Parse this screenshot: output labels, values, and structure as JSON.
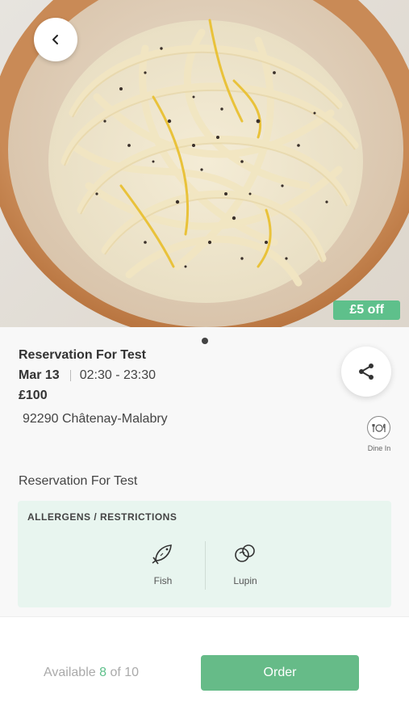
{
  "hero": {
    "discount": "£5 off",
    "carousel_count": 1,
    "carousel_active": 0
  },
  "listing": {
    "title": "Reservation For Test",
    "date": "Mar 13",
    "time": "02:30 - 23:30",
    "price": "£100",
    "address": "92290 Châtenay-Malabry",
    "service_type": "Dine In",
    "description": "Reservation For Test"
  },
  "allergens": {
    "title": "ALLERGENS / RESTRICTIONS",
    "items": [
      {
        "label": "Fish",
        "icon": "fish-icon"
      },
      {
        "label": "Lupin",
        "icon": "lupin-icon"
      }
    ]
  },
  "footer": {
    "available_prefix": "Available",
    "available_count": "8",
    "available_suffix": "of 10",
    "order_label": "Order"
  },
  "colors": {
    "accent": "#5ec08b",
    "allergen_bg": "#e8f5ef"
  }
}
